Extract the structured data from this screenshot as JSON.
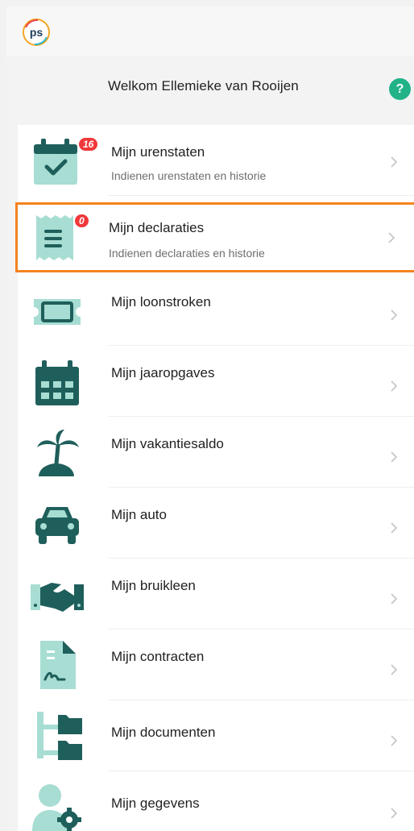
{
  "welcome": {
    "text": "Welkom Ellemieke van Rooijen",
    "help_label": "?"
  },
  "colors": {
    "icon_light": "#a7ddd3",
    "icon_dark": "#1f5f5b",
    "badge": "#f0383a",
    "selected_border": "#f58220",
    "help": "#21b28a"
  },
  "menu": [
    {
      "label": "Mijn urenstaten",
      "sub": "Indienen urenstaten en historie",
      "icon": "calendar-check-icon",
      "badge": "16"
    },
    {
      "label": "Mijn declaraties",
      "sub": "Indienen declaraties en historie",
      "icon": "receipt-icon",
      "badge": "0",
      "selected": true
    },
    {
      "label": "Mijn loonstroken",
      "icon": "ticket-icon"
    },
    {
      "label": "Mijn jaaropgaves",
      "icon": "calendar-icon"
    },
    {
      "label": "Mijn vakantiesaldo",
      "icon": "palm-island-icon"
    },
    {
      "label": "Mijn auto",
      "icon": "car-icon"
    },
    {
      "label": "Mijn bruikleen",
      "icon": "handshake-icon"
    },
    {
      "label": "Mijn contracten",
      "icon": "signed-document-icon"
    },
    {
      "label": "Mijn documenten",
      "icon": "folder-tree-icon"
    },
    {
      "label": "Mijn gegevens",
      "icon": "user-settings-icon"
    }
  ]
}
